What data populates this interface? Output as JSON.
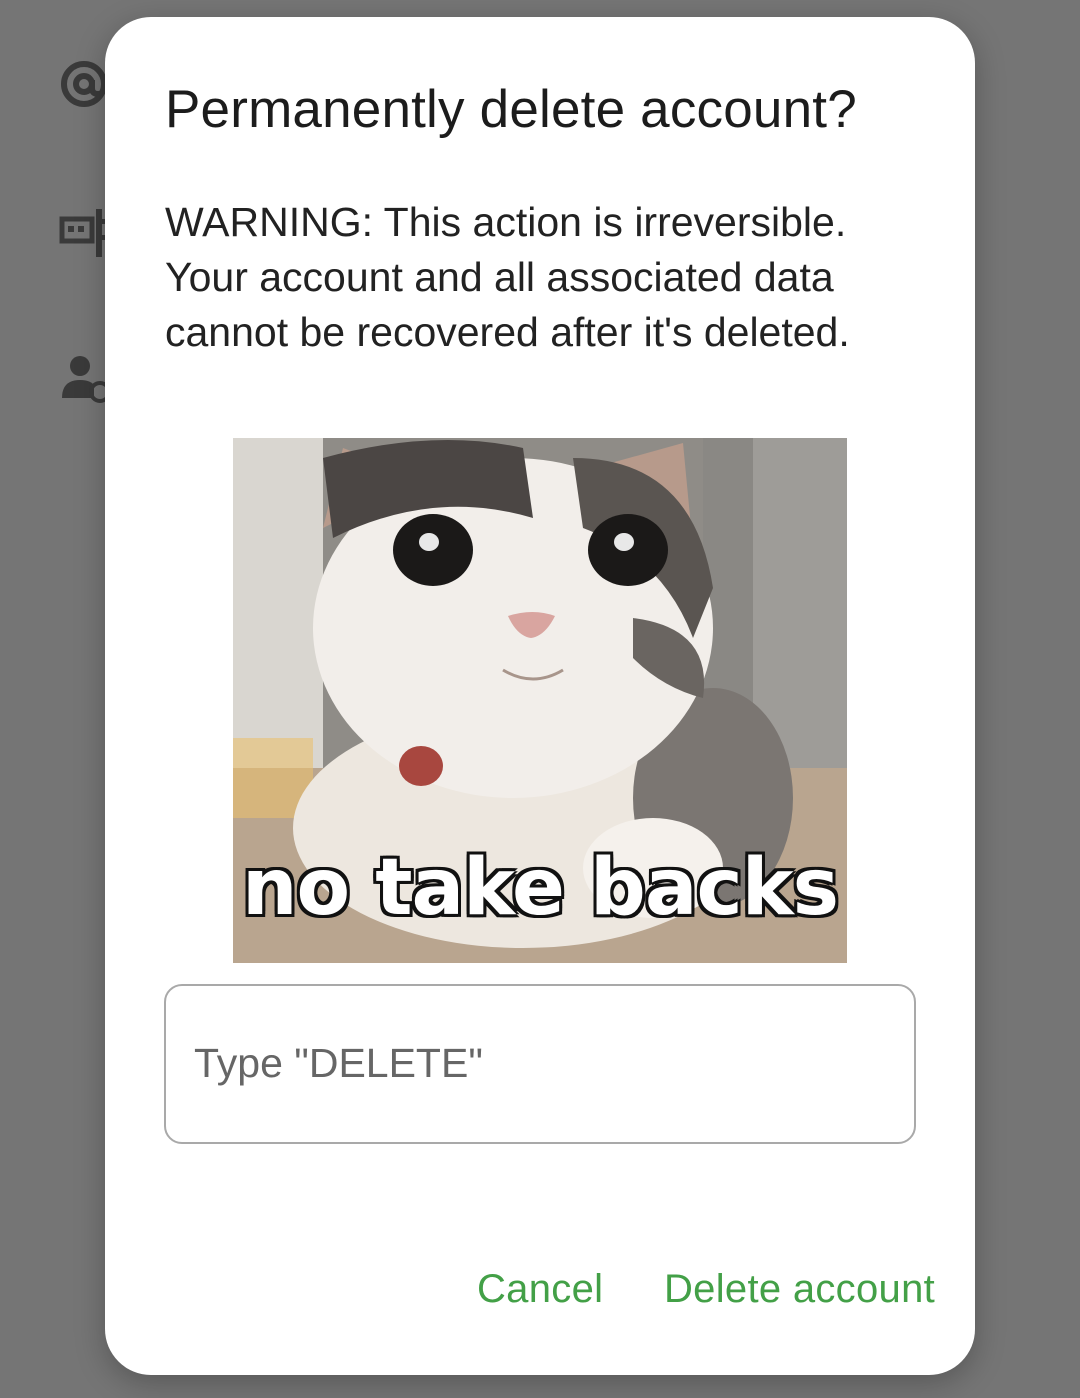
{
  "background": {
    "items": [
      {
        "icon": "at-sign-icon"
      },
      {
        "icon": "device-settings-icon"
      },
      {
        "icon": "manage-account-icon"
      }
    ]
  },
  "dialog": {
    "title": "Permanently delete account?",
    "message": "WARNING: This action is irreversible. Your account and all associated data cannot be recovered after it's deleted.",
    "image": {
      "subject": "white-and-grey-cat",
      "caption": "no take backs"
    },
    "confirm_input": {
      "placeholder": "Type \"DELETE\"",
      "value": ""
    },
    "buttons": {
      "cancel": "Cancel",
      "delete": "Delete account"
    }
  },
  "colors": {
    "scrim": "#757575",
    "dialog_bg": "#ffffff",
    "accent": "#43a047",
    "title_text": "#1c1c1c",
    "field_border": "#a9a9a9"
  }
}
